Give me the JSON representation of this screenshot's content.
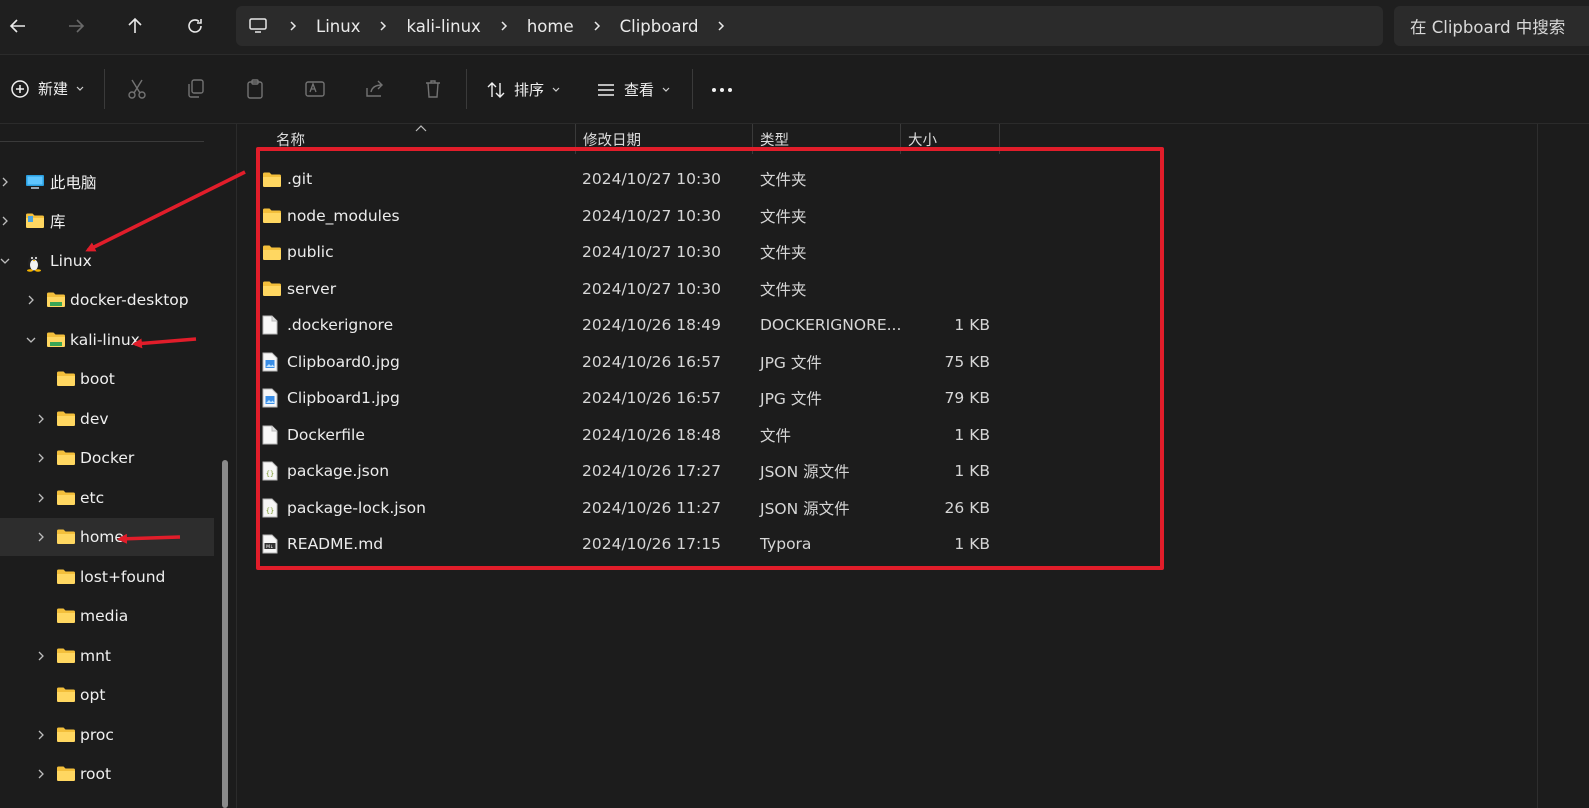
{
  "breadcrumb": [
    "Linux",
    "kali-linux",
    "home",
    "Clipboard"
  ],
  "search_placeholder": "在 Clipboard 中搜索",
  "toolbar": {
    "new_label": "新建",
    "sort_label": "排序",
    "view_label": "查看"
  },
  "columns": {
    "name": "名称",
    "date": "修改日期",
    "type": "类型",
    "size": "大小"
  },
  "sidebar": {
    "items": [
      {
        "label": "此电脑",
        "icon": "computer-icon",
        "chevron": "right"
      },
      {
        "label": "库",
        "icon": "library-folder-icon",
        "chevron": "right"
      },
      {
        "label": "Linux",
        "icon": "linux-penguin-icon",
        "chevron": "down"
      },
      {
        "label": "docker-desktop",
        "icon": "network-folder-icon",
        "chevron": "right"
      },
      {
        "label": "kali-linux",
        "icon": "network-folder-icon",
        "chevron": "down"
      },
      {
        "label": "boot",
        "icon": "folder-icon",
        "chevron": "none"
      },
      {
        "label": "dev",
        "icon": "folder-icon",
        "chevron": "right"
      },
      {
        "label": "Docker",
        "icon": "folder-icon",
        "chevron": "right"
      },
      {
        "label": "etc",
        "icon": "folder-icon",
        "chevron": "right"
      },
      {
        "label": "home",
        "icon": "folder-icon",
        "chevron": "right",
        "selected": true
      },
      {
        "label": "lost+found",
        "icon": "folder-icon",
        "chevron": "none"
      },
      {
        "label": "media",
        "icon": "folder-icon",
        "chevron": "none"
      },
      {
        "label": "mnt",
        "icon": "folder-icon",
        "chevron": "right"
      },
      {
        "label": "opt",
        "icon": "folder-icon",
        "chevron": "none"
      },
      {
        "label": "proc",
        "icon": "folder-icon",
        "chevron": "right"
      },
      {
        "label": "root",
        "icon": "folder-icon",
        "chevron": "right"
      }
    ]
  },
  "files": [
    {
      "name": ".git",
      "date": "2024/10/27 10:30",
      "type": "文件夹",
      "size": "",
      "icon": "folder-icon"
    },
    {
      "name": "node_modules",
      "date": "2024/10/27 10:30",
      "type": "文件夹",
      "size": "",
      "icon": "folder-icon"
    },
    {
      "name": "public",
      "date": "2024/10/27 10:30",
      "type": "文件夹",
      "size": "",
      "icon": "folder-icon"
    },
    {
      "name": "server",
      "date": "2024/10/27 10:30",
      "type": "文件夹",
      "size": "",
      "icon": "folder-icon"
    },
    {
      "name": ".dockerignore",
      "date": "2024/10/26 18:49",
      "type": "DOCKERIGNORE...",
      "size": "1 KB",
      "icon": "file-icon"
    },
    {
      "name": "Clipboard0.jpg",
      "date": "2024/10/26 16:57",
      "type": "JPG 文件",
      "size": "75 KB",
      "icon": "image-file-icon"
    },
    {
      "name": "Clipboard1.jpg",
      "date": "2024/10/26 16:57",
      "type": "JPG 文件",
      "size": "79 KB",
      "icon": "image-file-icon"
    },
    {
      "name": "Dockerfile",
      "date": "2024/10/26 18:48",
      "type": "文件",
      "size": "1 KB",
      "icon": "file-icon"
    },
    {
      "name": "package.json",
      "date": "2024/10/26 17:27",
      "type": "JSON 源文件",
      "size": "1 KB",
      "icon": "json-file-icon"
    },
    {
      "name": "package-lock.json",
      "date": "2024/10/26 11:27",
      "type": "JSON 源文件",
      "size": "26 KB",
      "icon": "json-file-icon"
    },
    {
      "name": "README.md",
      "date": "2024/10/26 17:15",
      "type": "Typora",
      "size": "1 KB",
      "icon": "markdown-file-icon"
    }
  ],
  "colors": {
    "highlight": "#e11d2a",
    "folder": "#f6c544",
    "background": "#1c1c1c"
  }
}
